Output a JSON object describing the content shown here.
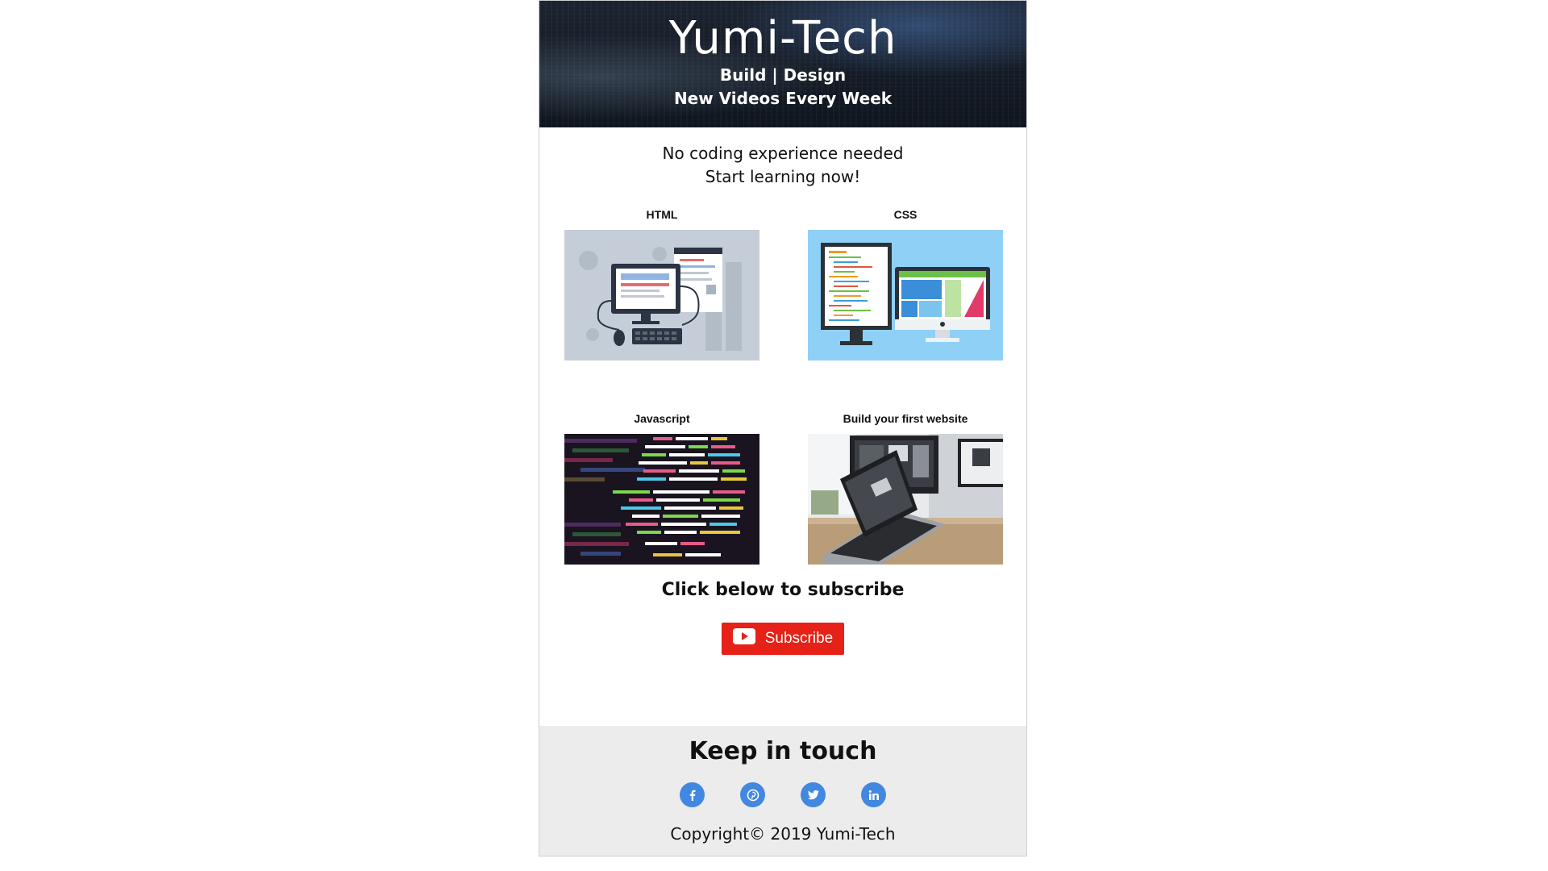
{
  "header": {
    "title": "Yumi-Tech",
    "tagline_part1": "Build",
    "tagline_sep": "|",
    "tagline_part2": "Design",
    "tagline_line2": "New Videos Every Week"
  },
  "intro": {
    "line1": "No coding experience needed",
    "line2": "Start learning now!"
  },
  "courses": [
    {
      "label": "HTML",
      "icon": "computer-illustration"
    },
    {
      "label": "CSS",
      "icon": "monitors-code-illustration"
    },
    {
      "label": "Javascript",
      "icon": "code-screen-photo"
    },
    {
      "label": "Build your first website",
      "icon": "laptop-desk-photo"
    }
  ],
  "subscribe": {
    "title": "Click below to subscribe",
    "button_label": "Subscribe",
    "button_color": "#e62117"
  },
  "footer": {
    "title": "Keep in touch",
    "socials": [
      "facebook-icon",
      "pinterest-icon",
      "twitter-icon",
      "linkedin-icon"
    ],
    "social_color": "#4287e0",
    "copyright": "Copyright© 2019 Yumi-Tech"
  }
}
